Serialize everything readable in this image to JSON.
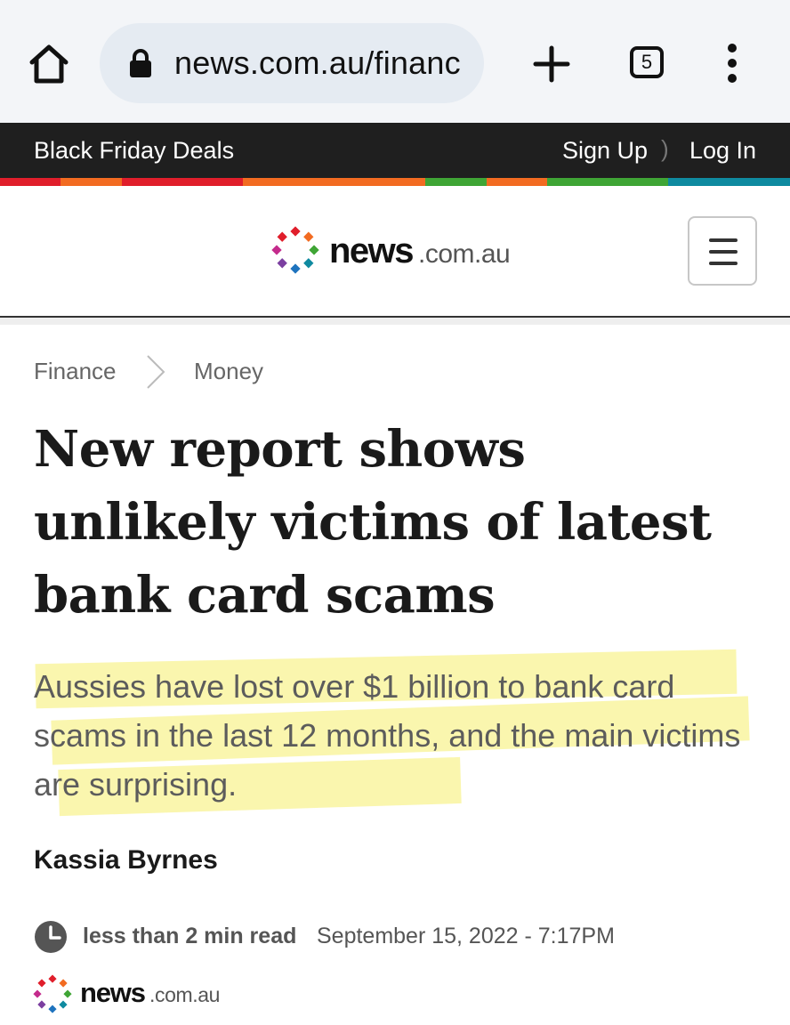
{
  "browser": {
    "url": "news.com.au/financ",
    "tab_count": "5",
    "icons": [
      "home-icon",
      "lock-icon",
      "new-tab-plus-icon",
      "tab-switcher-icon",
      "overflow-menu-icon"
    ]
  },
  "topbar": {
    "promo": "Black Friday Deals",
    "sign_up": "Sign Up",
    "log_in": "Log In",
    "strip_colors": [
      "#e01e2b",
      "#f26b21",
      "#e01e2b",
      "#e01e2b",
      "#f26b21",
      "#f26b21",
      "#f26b21",
      "#3fa535",
      "#f26b21",
      "#3fa535",
      "#3fa535",
      "#0f8aa0",
      "#0f8aa0"
    ]
  },
  "masthead": {
    "logo_word": "news",
    "logo_domain": ".com.au",
    "dot_colors": [
      "#e01e2b",
      "#f26b21",
      "#3fa535",
      "#0f8aa0",
      "#1e73be",
      "#7b3fa0",
      "#c42b8c",
      "#e01e2b"
    ]
  },
  "article": {
    "breadcrumb": [
      "Finance",
      "Money"
    ],
    "headline": "New report shows unlikely victims of latest bank card scams",
    "standfirst": "Aussies have lost over $1 billion to bank card scams in the last 12 months, and the main victims are surprising.",
    "author": "Kassia Byrnes",
    "read_time": "less than 2 min read",
    "published": "September 15, 2022 - 7:17PM"
  },
  "colors": {
    "topbar_bg": "#1f1f1f",
    "highlight": "#f7f078",
    "headline": "#1a1a1a",
    "standfirst": "#5c5c5c"
  }
}
